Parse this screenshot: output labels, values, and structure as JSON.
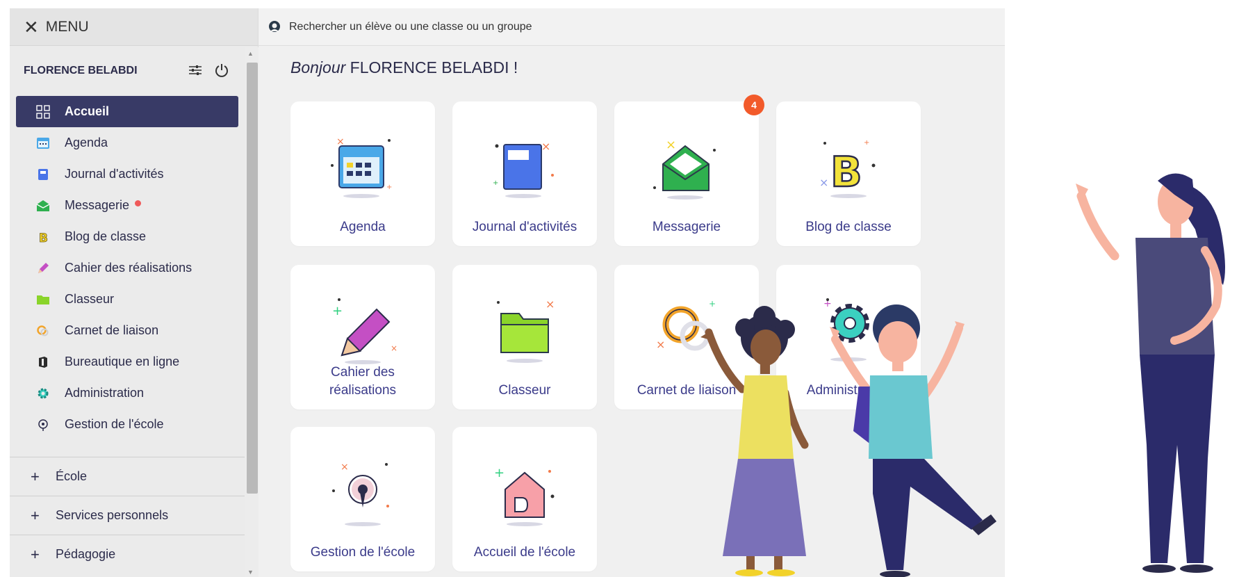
{
  "menu": {
    "label": "MENU"
  },
  "user": {
    "name": "FLORENCE BELABDI"
  },
  "nav": [
    {
      "label": "Accueil",
      "icon": "grid-icon"
    },
    {
      "label": "Agenda",
      "icon": "calendar-icon"
    },
    {
      "label": "Journal d'activités",
      "icon": "journal-icon"
    },
    {
      "label": "Messagerie",
      "icon": "envelope-icon"
    },
    {
      "label": "Blog de classe",
      "icon": "blog-icon"
    },
    {
      "label": "Cahier des réalisations",
      "icon": "pencil-icon"
    },
    {
      "label": "Classeur",
      "icon": "folder-icon"
    },
    {
      "label": "Carnet de liaison",
      "icon": "link-icon"
    },
    {
      "label": "Bureautique en ligne",
      "icon": "office-icon"
    },
    {
      "label": "Administration",
      "icon": "gear-icon"
    },
    {
      "label": "Gestion de l'école",
      "icon": "location-icon"
    }
  ],
  "sections": [
    {
      "label": "École"
    },
    {
      "label": "Services personnels"
    },
    {
      "label": "Pédagogie"
    }
  ],
  "search": {
    "placeholder": "Rechercher un élève ou une classe ou un groupe"
  },
  "greeting": {
    "prefix": "Bonjour",
    "name": "FLORENCE BELABDI !"
  },
  "tiles": [
    {
      "label": "Agenda",
      "icon": "calendar-icon"
    },
    {
      "label": "Journal d'activités",
      "icon": "journal-icon"
    },
    {
      "label": "Messagerie",
      "icon": "envelope-icon",
      "badge": "4"
    },
    {
      "label": "Blog de classe",
      "icon": "blog-icon"
    },
    {
      "label": "Cahier des réalisations",
      "icon": "pencil-icon"
    },
    {
      "label": "Classeur",
      "icon": "folder-icon"
    },
    {
      "label": "Carnet de liaison",
      "icon": "link-icon"
    },
    {
      "label": "Administration",
      "icon": "gear-icon"
    },
    {
      "label": "Gestion de l'école",
      "icon": "location-icon"
    },
    {
      "label": "Accueil de l'école",
      "icon": "house-icon"
    }
  ],
  "colors": {
    "active_nav": "#383a66",
    "tile_label": "#3b3b8a",
    "badge": "#f25a2a",
    "notif_dot": "#ef5a5a"
  }
}
